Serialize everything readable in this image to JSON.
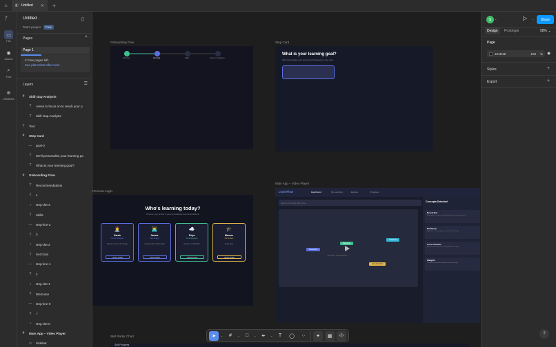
{
  "titlebar": {
    "tab_label": "Untitled",
    "tab_close": "✕",
    "new_tab": "+"
  },
  "rail": [
    {
      "icon": "file-icon",
      "label": "File"
    },
    {
      "icon": "assets-icon",
      "label": "Assets"
    },
    {
      "icon": "find-icon",
      "label": "Find"
    },
    {
      "icon": "variables-icon",
      "label": "Variables"
    }
  ],
  "project": {
    "title": "Untitled",
    "team": "Team project",
    "plan": "Free"
  },
  "pages": {
    "header": "Pages",
    "current": "Page 1",
    "free_line": "2 Free pages left.",
    "free_link": "See plans that offer more"
  },
  "layers": {
    "header": "Layers",
    "items": [
      {
        "name": "Skill Gap Analysis",
        "icon": "#",
        "level": 0,
        "bold": true
      },
      {
        "name": "Areas to focus on to reach your p",
        "icon": "T",
        "level": 1
      },
      {
        "name": "Skill Gap Analysis",
        "icon": "T",
        "level": 1
      },
      {
        "name": "Text",
        "icon": "T",
        "level": 0
      },
      {
        "name": "Step Card",
        "icon": "#",
        "level": 0,
        "bold": true
      },
      {
        "name": "goal-0",
        "icon": "—",
        "level": 1
      },
      {
        "name": "We'll personalise your learning pa",
        "icon": "T",
        "level": 1
      },
      {
        "name": "What is your learning goal?",
        "icon": "T",
        "level": 1
      },
      {
        "name": "Onboarding Flow",
        "icon": "#",
        "level": 0,
        "bold": true
      },
      {
        "name": "Recommendations",
        "icon": "T",
        "level": 1
      },
      {
        "name": "4",
        "icon": "T",
        "level": 1
      },
      {
        "name": "step-dot-3",
        "icon": "○",
        "level": 1
      },
      {
        "name": "Skills",
        "icon": "T",
        "level": 1
      },
      {
        "name": "step-line-2",
        "icon": "—",
        "level": 1
      },
      {
        "name": "3",
        "icon": "T",
        "level": 1
      },
      {
        "name": "step-dot-2",
        "icon": "○",
        "level": 1
      },
      {
        "name": "Set Goal",
        "icon": "T",
        "level": 1
      },
      {
        "name": "step-line-1",
        "icon": "—",
        "level": 1
      },
      {
        "name": "2",
        "icon": "T",
        "level": 1
      },
      {
        "name": "step-dot-1",
        "icon": "○",
        "level": 1
      },
      {
        "name": "Welcome",
        "icon": "T",
        "level": 1
      },
      {
        "name": "step-line-0",
        "icon": "—",
        "level": 1
      },
      {
        "name": "✓",
        "icon": "T",
        "level": 1
      },
      {
        "name": "step-dot-0",
        "icon": "○",
        "level": 1
      },
      {
        "name": "Main App – Video Player",
        "icon": "#",
        "level": 0,
        "bold": true
      },
      {
        "name": "Sidebar",
        "icon": "▭",
        "level": 1
      }
    ]
  },
  "canvas": {
    "onboarding": {
      "label": "Onboarding Flow",
      "steps": [
        "Welcome",
        "Set Goal",
        "Skills",
        "Recommendations"
      ],
      "dot_numbers": [
        "✓",
        "2",
        "3",
        "4"
      ]
    },
    "step_card": {
      "label": "Step Card",
      "title": "What is your learning goal?",
      "subtitle": "We'll personalise your learning path based on your goal"
    },
    "persona": {
      "label": "Persona Login",
      "title": "Who's learning today?",
      "subtitle": "Choose your profile to get personalised recommendations",
      "cards": [
        {
          "emoji": "👩‍💼",
          "name": "Sarah",
          "role": "Product Designer",
          "desc": "Wants to learn UX strategy",
          "button": "Select Profile",
          "accent": "#5b6ee1"
        },
        {
          "emoji": "👨‍💻",
          "name": "James",
          "role": "Data Analyst",
          "desc": "Learning ML fundamentals",
          "button": "Select Profile",
          "accent": "#5b6ee1"
        },
        {
          "emoji": "☁️",
          "name": "Priya",
          "role": "Cloud Engineer",
          "desc": "Going for certification",
          "button": "Select Profile",
          "accent": "#3fbf8f"
        },
        {
          "emoji": "🎓",
          "name": "Marcus",
          "role": "CS Student",
          "desc": "Exam prep",
          "button": "Select Profile",
          "accent": "#e2b44a"
        }
      ]
    },
    "main_app": {
      "label": "Main App – Video Player",
      "brand": "LearnFlow",
      "nav": [
        "Dashboard",
        "My Learning",
        "Explore",
        "Progress"
      ],
      "search_placeholder": "Search YouTube URL here...",
      "video_caption": "YouTube Video Player",
      "nodes": [
        "Neural Net",
        "Backprop",
        "Loss Function",
        "Gradients"
      ],
      "concepts_header": "Concepts Detected",
      "concepts": [
        {
          "title": "Neural Net",
          "desc": "A computing system inspired by biological neural networks"
        },
        {
          "title": "Backprop",
          "desc": "Algorithm for training neural networks efficiently"
        },
        {
          "title": "Loss Function",
          "desc": "Measures how well the model performs on data"
        },
        {
          "title": "Weights",
          "desc": "Learnable parameters adjusted during training"
        }
      ]
    },
    "radar": {
      "label": "Skill Radar Chart",
      "sublabel": "Skill Progress"
    }
  },
  "right": {
    "avatar": "S",
    "share": "Share",
    "tabs": [
      "Design",
      "Prototype"
    ],
    "zoom": "58%",
    "page_header": "Page",
    "page_color": "1E1E1E",
    "page_opacity": "100",
    "page_pct": "%",
    "styles": "Styles",
    "export": "Export"
  },
  "help": "?"
}
